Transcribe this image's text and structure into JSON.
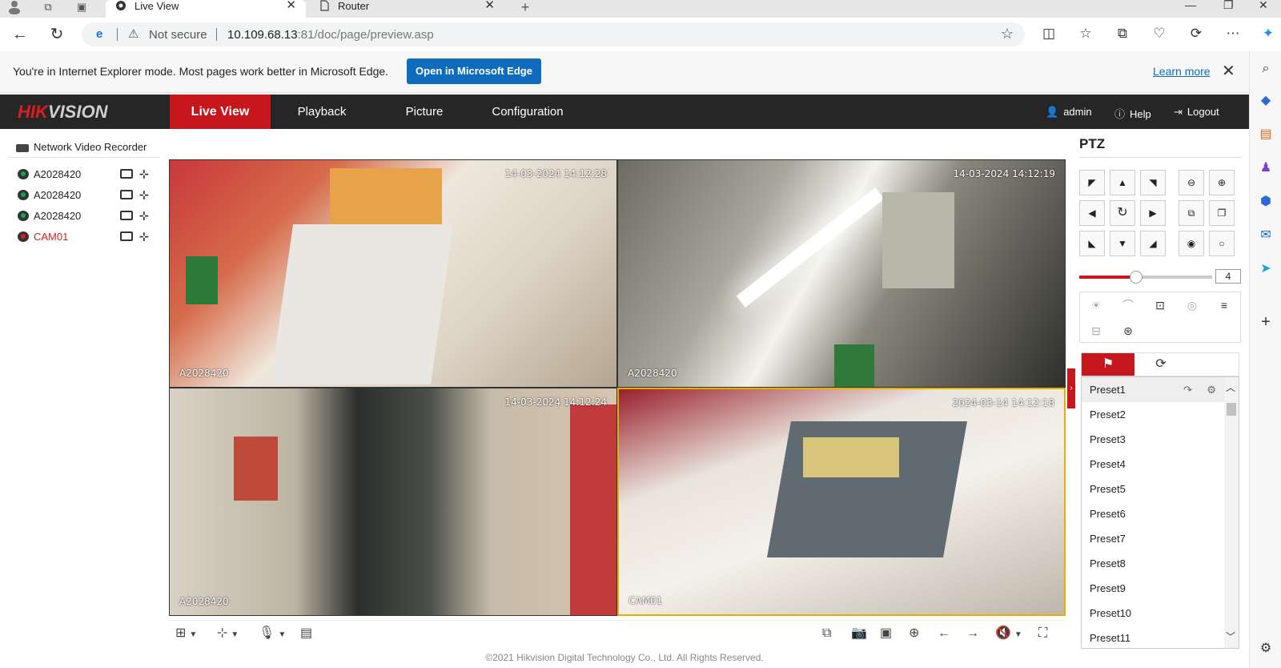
{
  "browser": {
    "tabs": [
      {
        "title": "Live View",
        "active": true
      },
      {
        "title": "Router",
        "active": false
      }
    ],
    "address": {
      "security": "Not secure",
      "host": "10.109.68.13",
      "port_path": ":81/doc/page/preview.asp"
    },
    "ie_bar": {
      "message": "You're in Internet Explorer mode. Most pages work better in Microsoft Edge.",
      "open_button": "Open in Microsoft Edge",
      "learn_more": "Learn more"
    }
  },
  "app": {
    "logo_red": "HIK",
    "logo_gray": "VISION",
    "nav": [
      "Live View",
      "Playback",
      "Picture",
      "Configuration"
    ],
    "active_nav": "Live View",
    "user": "admin",
    "help": "Help",
    "logout": "Logout"
  },
  "device_tree": {
    "root": "Network Video Recorder",
    "cameras": [
      {
        "name": "A2028420",
        "status": "normal"
      },
      {
        "name": "A2028420",
        "status": "normal"
      },
      {
        "name": "A2028420",
        "status": "normal"
      },
      {
        "name": "CAM01",
        "status": "active"
      }
    ]
  },
  "video": {
    "cells": [
      {
        "timestamp": "14-03-2024 14:12:28",
        "camera": "A2028420",
        "selected": false
      },
      {
        "timestamp": "14-03-2024 14:12:19",
        "camera": "A2028420",
        "selected": false
      },
      {
        "timestamp": "14-03-2024 14:12:24",
        "camera": "A2028420",
        "selected": false
      },
      {
        "timestamp": "2024-03-14 14:12:18",
        "camera": "CAM01",
        "selected": true
      }
    ]
  },
  "ptz": {
    "title": "PTZ",
    "speed": "4",
    "speed_level": 0.43,
    "presets": [
      "Preset1",
      "Preset2",
      "Preset3",
      "Preset4",
      "Preset5",
      "Preset6",
      "Preset7",
      "Preset8",
      "Preset9",
      "Preset10",
      "Preset11"
    ]
  },
  "footer": "©2021 Hikvision Digital Technology Co., Ltd. All Rights Reserved."
}
